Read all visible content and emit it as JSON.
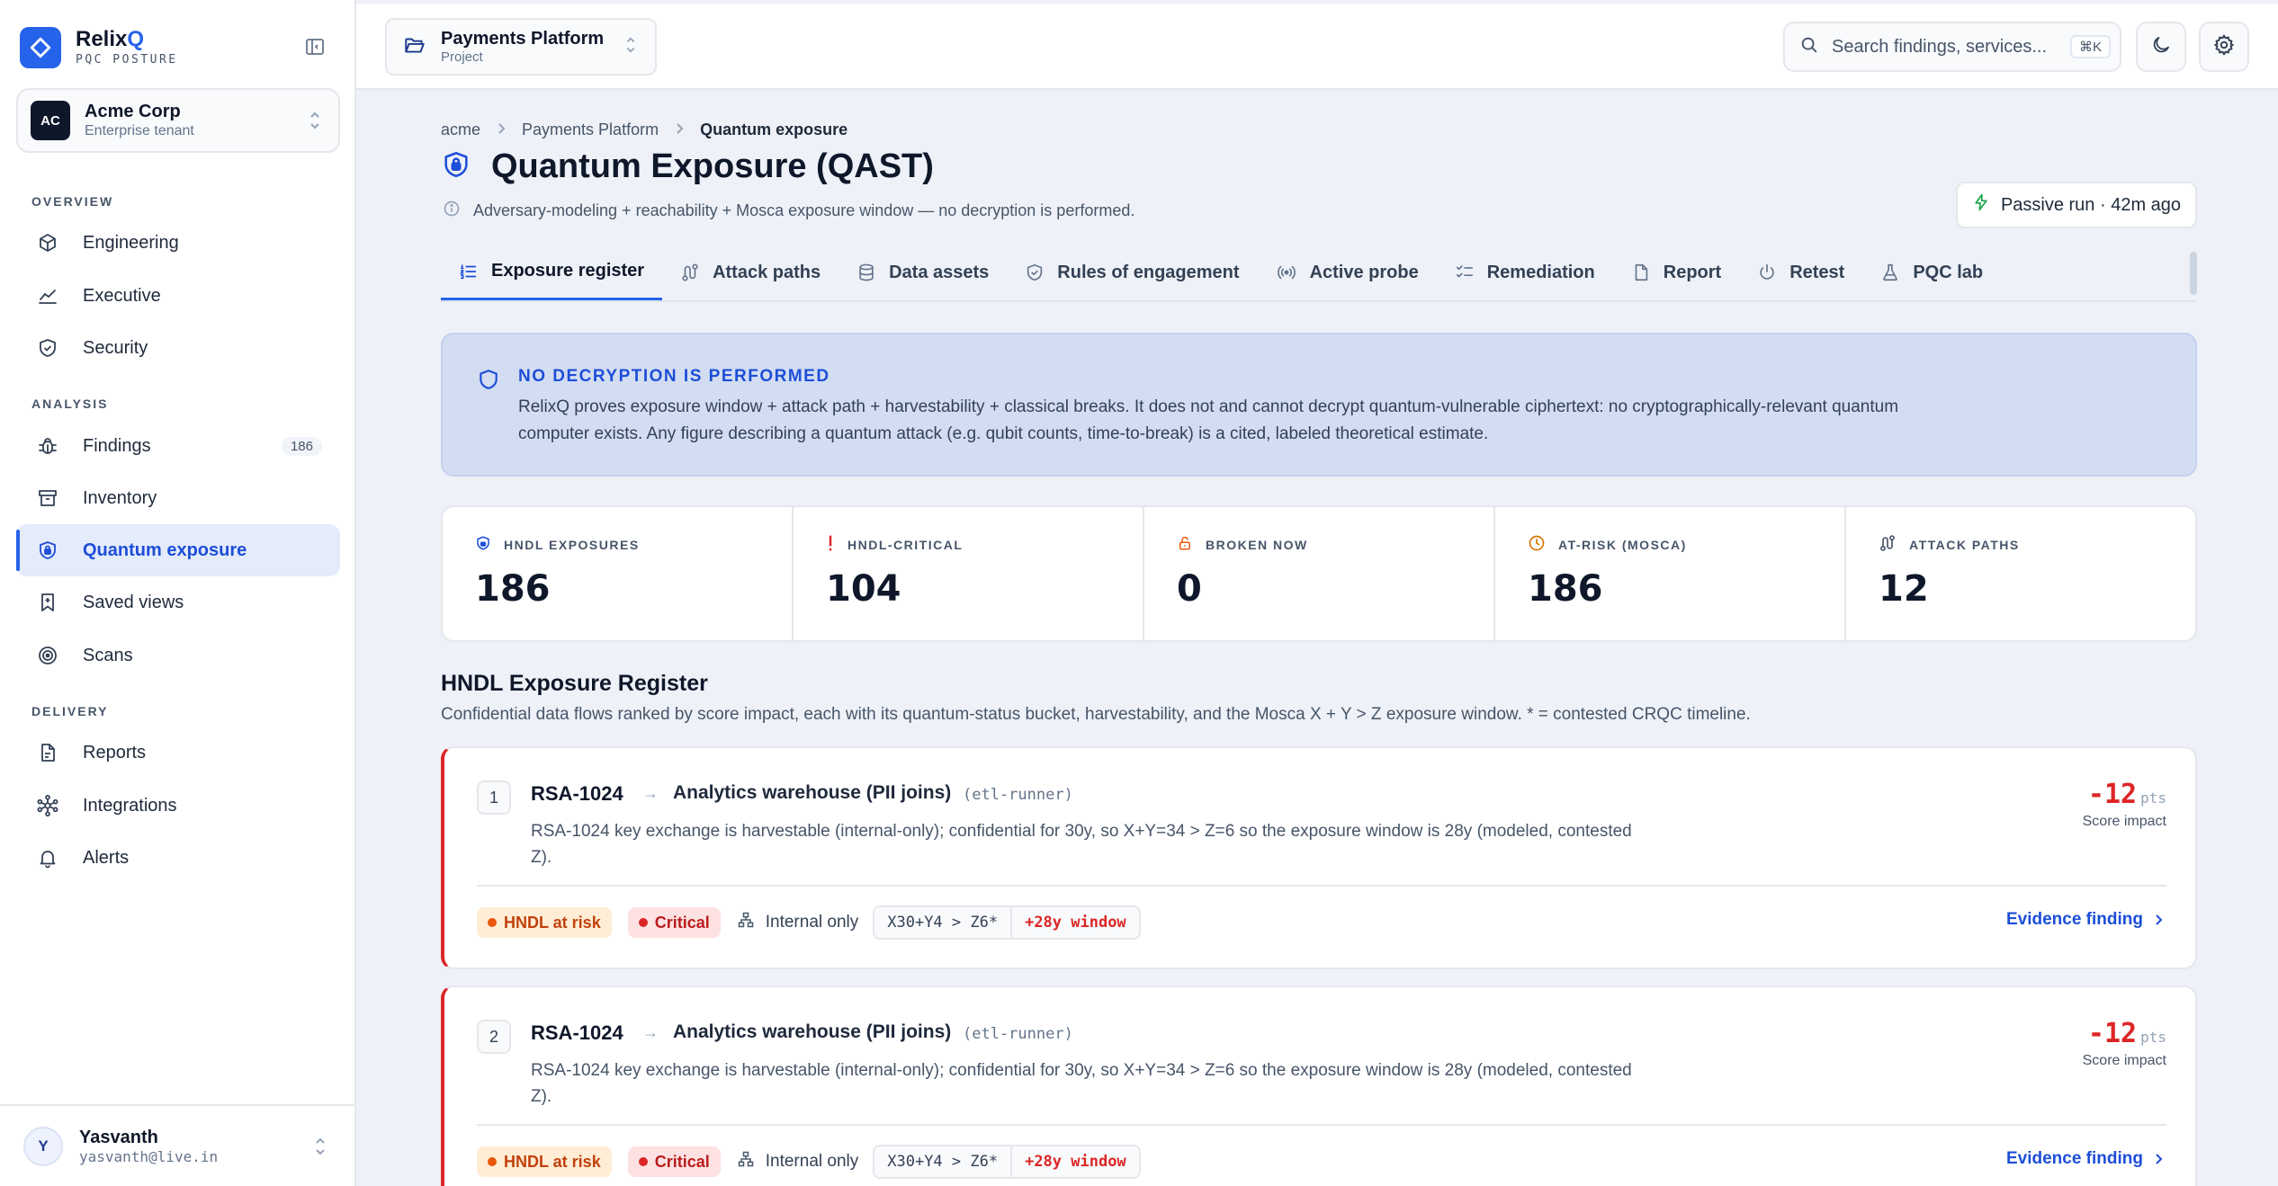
{
  "brand": {
    "name_main": "Relix",
    "name_accent": "Q",
    "subtitle": "PQC POSTURE"
  },
  "tenant": {
    "initials": "AC",
    "name": "Acme Corp",
    "type": "Enterprise tenant"
  },
  "nav": {
    "overview_label": "OVERVIEW",
    "analysis_label": "ANALYSIS",
    "delivery_label": "DELIVERY",
    "engineering": "Engineering",
    "executive": "Executive",
    "security": "Security",
    "findings": "Findings",
    "findings_count": "186",
    "inventory": "Inventory",
    "quantum_exposure": "Quantum exposure",
    "saved_views": "Saved views",
    "scans": "Scans",
    "reports": "Reports",
    "integrations": "Integrations",
    "alerts": "Alerts"
  },
  "user": {
    "initial": "Y",
    "name": "Yasvanth",
    "email": "yasvanth@live.in"
  },
  "header": {
    "project_name": "Payments Platform",
    "project_type": "Project",
    "search_placeholder": "Search findings, services...",
    "search_shortcut": "⌘K"
  },
  "breadcrumb": {
    "org": "acme",
    "project": "Payments Platform",
    "current": "Quantum exposure"
  },
  "page": {
    "title": "Quantum Exposure (QAST)",
    "subtitle": "Adversary-modeling + reachability + Mosca exposure window — no decryption is performed.",
    "run_status": "Passive run · 42m ago"
  },
  "tabs": {
    "exposure_register": "Exposure register",
    "attack_paths": "Attack paths",
    "data_assets": "Data assets",
    "rules_of_engagement": "Rules of engagement",
    "active_probe": "Active probe",
    "remediation": "Remediation",
    "report": "Report",
    "retest": "Retest",
    "pqc_lab": "PQC lab"
  },
  "notice": {
    "title": "NO DECRYPTION IS PERFORMED",
    "body": "RelixQ proves exposure window + attack path + harvestability + classical breaks. It does not and cannot decrypt quantum-vulnerable ciphertext: no cryptographically-relevant quantum computer exists. Any figure describing a quantum attack (e.g. qubit counts, time-to-break) is a cited, labeled theoretical estimate."
  },
  "stats": {
    "hndl_exposures_label": "HNDL EXPOSURES",
    "hndl_exposures_value": "186",
    "hndl_critical_label": "HNDL-CRITICAL",
    "hndl_critical_value": "104",
    "broken_now_label": "BROKEN NOW",
    "broken_now_value": "0",
    "at_risk_label": "AT-RISK (MOSCA)",
    "at_risk_value": "186",
    "attack_paths_label": "ATTACK PATHS",
    "attack_paths_value": "12"
  },
  "register": {
    "title": "HNDL Exposure Register",
    "subtitle": "Confidential data flows ranked by score impact, each with its quantum-status bucket, harvestability, and the Mosca X + Y > Z exposure window. * = contested CRQC timeline.",
    "items": [
      {
        "rank": "1",
        "algorithm": "RSA-1024",
        "arrow": "→",
        "target": "Analytics warehouse (PII joins)",
        "service": "(etl-runner)",
        "description": "RSA-1024 key exchange is harvestable (internal-only); confidential for 30y, so X+Y=34 > Z=6 so the exposure window is 28y (modeled, contested Z).",
        "score": "-12",
        "score_unit": "pts",
        "score_label": "Score impact",
        "status_badge": "HNDL at risk",
        "severity_badge": "Critical",
        "reachability": "Internal only",
        "mosca_equation": "X30+Y4 > Z6*",
        "mosca_window": "+28y window",
        "evidence_link": "Evidence finding"
      },
      {
        "rank": "2",
        "algorithm": "RSA-1024",
        "arrow": "→",
        "target": "Analytics warehouse (PII joins)",
        "service": "(etl-runner)",
        "description": "RSA-1024 key exchange is harvestable (internal-only); confidential for 30y, so X+Y=34 > Z=6 so the exposure window is 28y (modeled, contested Z).",
        "score": "-12",
        "score_unit": "pts",
        "score_label": "Score impact",
        "status_badge": "HNDL at risk",
        "severity_badge": "Critical",
        "reachability": "Internal only",
        "mosca_equation": "X30+Y4 > Z6*",
        "mosca_window": "+28y window",
        "evidence_link": "Evidence finding"
      }
    ]
  },
  "colors": {
    "accent": "#2563eb",
    "critical": "#dc2626",
    "warning": "#ea580c",
    "notice_bg": "#d3ddf2"
  }
}
